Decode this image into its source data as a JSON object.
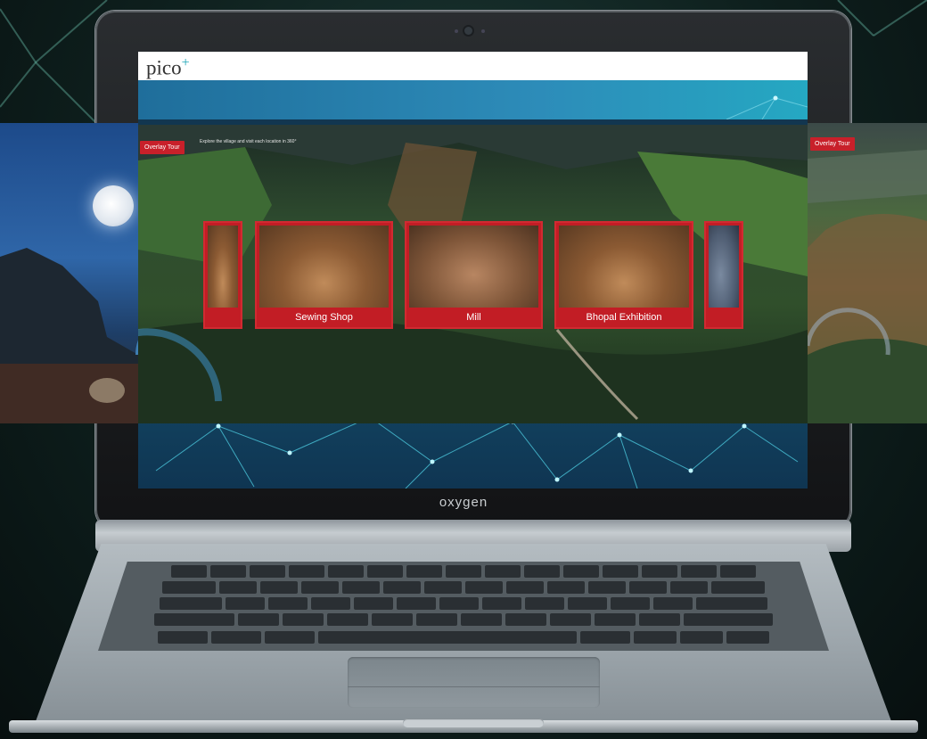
{
  "device": {
    "brand_label": "oxygen"
  },
  "site": {
    "logo_text": "pico",
    "logo_plus": "+"
  },
  "panorama_overlay": {
    "badge_center": "Overlay Tour",
    "badge_right": "Overlay Tour",
    "caption_text": "Explore the village and visit each location in 360°"
  },
  "cards": [
    {
      "label": ""
    },
    {
      "label": "Sewing Shop"
    },
    {
      "label": "Mill"
    },
    {
      "label": "Bhopal Exhibition"
    },
    {
      "label": ""
    }
  ],
  "colors": {
    "accent_red": "#c21d25",
    "header_blue": "#2d8cb9",
    "logo_teal": "#1ea6b7"
  }
}
